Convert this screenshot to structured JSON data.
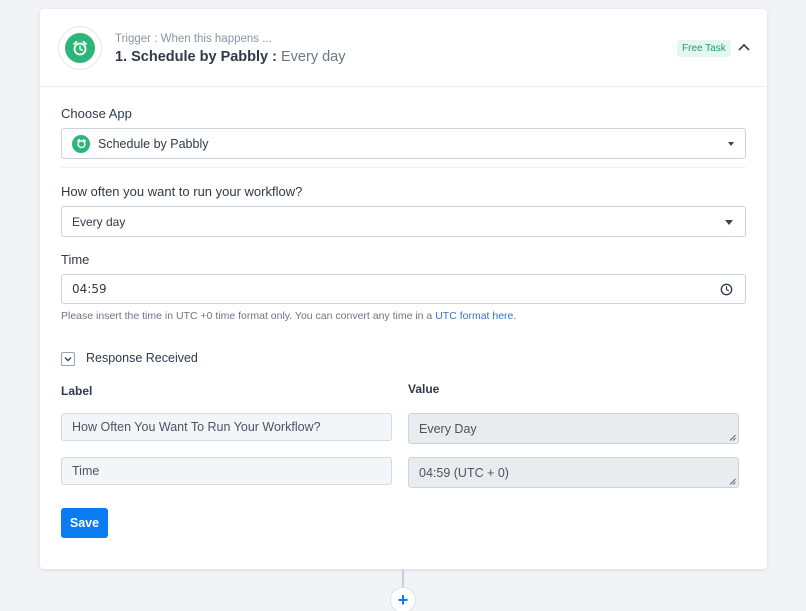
{
  "trigger": {
    "subtitle": "Trigger : When this happens ...",
    "title": "1. Schedule by Pabbly :",
    "title_detail": "Every day",
    "badge": "Free Task",
    "icon": "alarm-clock-icon",
    "collapse_icon": "chevron-up-icon"
  },
  "form": {
    "choose_app_label": "Choose App",
    "app_value": "Schedule by Pabbly",
    "frequency_label": "How often you want to run your workflow?",
    "frequency_value": "Every day",
    "time_label": "Time",
    "time_value": "04:59",
    "help_text": "Please insert the time in UTC +0 time format only. You can convert any time in a",
    "help_link": "UTC format here."
  },
  "response": {
    "toggle_label": "Response Received",
    "columns": {
      "label": "Label",
      "value": "Value"
    },
    "rows": [
      {
        "label": "How Often You Want To Run Your Workflow?",
        "value": "Every Day"
      },
      {
        "label": "Time",
        "value": "04:59 (UTC + 0)"
      }
    ]
  },
  "actions": {
    "save_label": "Save",
    "add_step_symbol": "+"
  },
  "colors": {
    "accent": "#0a7cf2",
    "brand_green": "#2eb57a",
    "badge_bg": "#e4f7ee"
  }
}
